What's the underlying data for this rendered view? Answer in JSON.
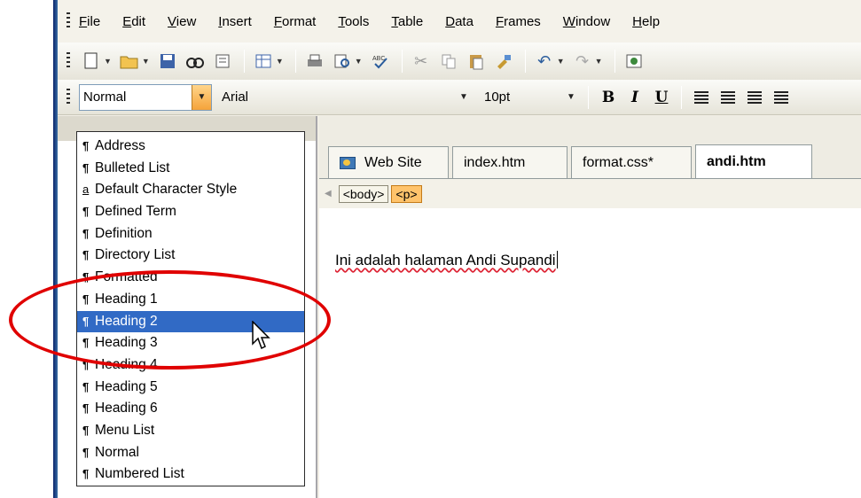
{
  "menubar": {
    "items": [
      "File",
      "Edit",
      "View",
      "Insert",
      "Format",
      "Tools",
      "Table",
      "Data",
      "Frames",
      "Window",
      "Help"
    ]
  },
  "formatting": {
    "style_value": "Normal",
    "font_value": "Arial",
    "size_value": "10pt",
    "bold": "B",
    "italic": "I",
    "underline": "U"
  },
  "tabs": [
    {
      "label": "Web Site"
    },
    {
      "label": "index.htm"
    },
    {
      "label": "format.css*"
    },
    {
      "label": "andi.htm"
    }
  ],
  "breadcrumb": [
    "<body>",
    "<p>"
  ],
  "document": {
    "text": "Ini adalah halaman Andi Supandi"
  },
  "style_dropdown": {
    "items": [
      {
        "label": "Address",
        "icon": "¶"
      },
      {
        "label": "Bulleted List",
        "icon": "¶"
      },
      {
        "label": "Default Character Style",
        "icon": "a"
      },
      {
        "label": "Defined Term",
        "icon": "¶"
      },
      {
        "label": "Definition",
        "icon": "¶"
      },
      {
        "label": "Directory List",
        "icon": "¶"
      },
      {
        "label": "Formatted",
        "icon": "¶"
      },
      {
        "label": "Heading 1",
        "icon": "¶"
      },
      {
        "label": "Heading 2",
        "icon": "¶"
      },
      {
        "label": "Heading 3",
        "icon": "¶"
      },
      {
        "label": "Heading 4",
        "icon": "¶"
      },
      {
        "label": "Heading 5",
        "icon": "¶"
      },
      {
        "label": "Heading 6",
        "icon": "¶"
      },
      {
        "label": "Menu List",
        "icon": "¶"
      },
      {
        "label": "Normal",
        "icon": "¶"
      },
      {
        "label": "Numbered List",
        "icon": "¶"
      }
    ],
    "selected_index": 8
  },
  "colors": {
    "selection": "#316ac5",
    "annotation": "#e00000",
    "active_tag": "#ffc36b"
  }
}
